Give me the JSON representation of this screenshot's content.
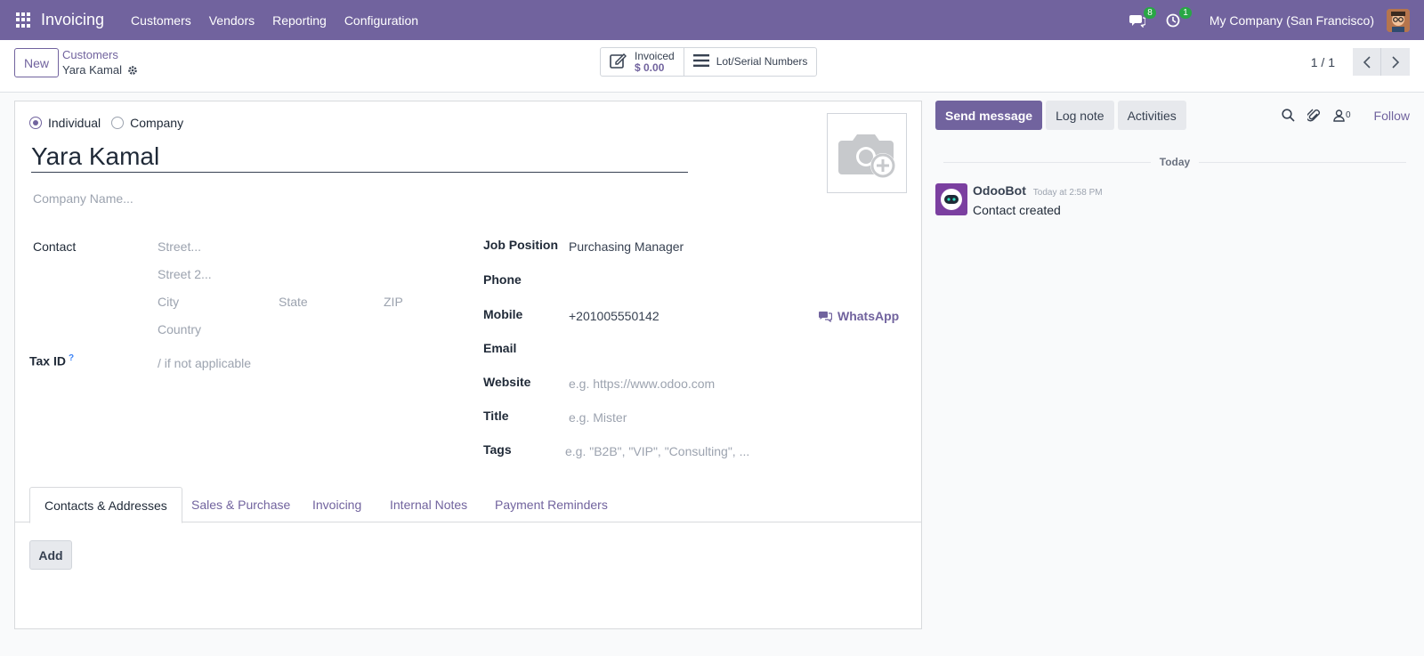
{
  "navbar": {
    "app_name": "Invoicing",
    "menu": [
      "Customers",
      "Vendors",
      "Reporting",
      "Configuration"
    ],
    "messages_badge": "8",
    "activities_badge": "1",
    "company": "My Company (San Francisco)"
  },
  "control_panel": {
    "new_label": "New",
    "breadcrumb_parent": "Customers",
    "breadcrumb_current": "Yara Kamal",
    "smart_invoiced_label": "Invoiced",
    "smart_invoiced_value": "$ 0.00",
    "smart_lots_label": "Lot/Serial Numbers",
    "pager": "1 / 1"
  },
  "form": {
    "type_individual": "Individual",
    "type_company": "Company",
    "name": "Yara Kamal",
    "company_name_placeholder": "Company Name...",
    "contact_label": "Contact",
    "street_placeholder": "Street...",
    "street2_placeholder": "Street 2...",
    "city_placeholder": "City",
    "state_placeholder": "State",
    "zip_placeholder": "ZIP",
    "country_placeholder": "Country",
    "tax_id_label": "Tax ID",
    "tax_id_help": "?",
    "tax_id_placeholder": "/ if not applicable",
    "job_position_label": "Job Position",
    "job_position_value": "Purchasing Manager",
    "phone_label": "Phone",
    "mobile_label": "Mobile",
    "mobile_value": "+201005550142",
    "whatsapp_label": "WhatsApp",
    "email_label": "Email",
    "website_label": "Website",
    "website_placeholder": "e.g. https://www.odoo.com",
    "title_label": "Title",
    "title_placeholder": "e.g. Mister",
    "tags_label": "Tags",
    "tags_placeholder": "e.g. \"B2B\", \"VIP\", \"Consulting\", ..."
  },
  "tabs": [
    "Contacts & Addresses",
    "Sales & Purchase",
    "Invoicing",
    "Internal Notes",
    "Payment Reminders"
  ],
  "add_label": "Add",
  "chatter": {
    "send_message": "Send message",
    "log_note": "Log note",
    "activities": "Activities",
    "followers_count": "0",
    "follow": "Follow",
    "today": "Today",
    "message_author": "OdooBot",
    "message_date": "Today at 2:58 PM",
    "message_body": "Contact created"
  },
  "colors": {
    "brand": "#71639e",
    "badge": "#28a745"
  }
}
